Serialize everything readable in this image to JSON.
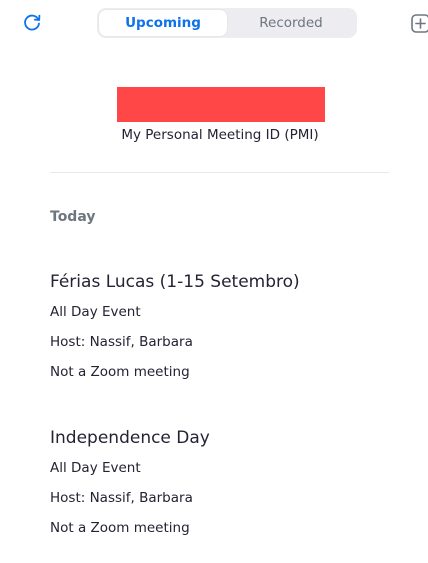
{
  "header": {
    "tabs": [
      {
        "label": "Upcoming",
        "active": true
      },
      {
        "label": "Recorded",
        "active": false
      }
    ],
    "refresh_icon": "refresh-icon",
    "add_icon": "plus-square-icon"
  },
  "pmi": {
    "label": "My Personal Meeting ID (PMI)",
    "redaction_color": "#ff4747"
  },
  "schedule": {
    "day_label": "Today",
    "meetings": [
      {
        "title": "Férias Lucas (1-15 Setembro)",
        "time": "All Day Event",
        "host": "Host: Nassif, Barbara",
        "type": "Not a Zoom meeting"
      },
      {
        "title": "Independence Day",
        "time": "All Day Event",
        "host": "Host: Nassif, Barbara",
        "type": "Not a Zoom meeting"
      }
    ]
  },
  "colors": {
    "accent": "#0e72ed",
    "text": "#232333",
    "muted": "#6e7680"
  }
}
